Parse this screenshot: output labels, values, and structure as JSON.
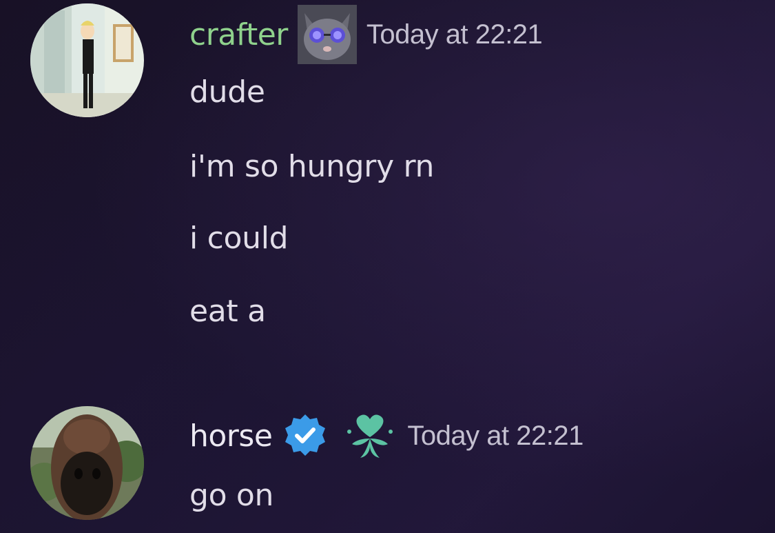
{
  "messages": [
    {
      "username": "crafter",
      "username_color": "#8fd18c",
      "timestamp": "Today at 22:21",
      "avatar_icon": "cartoon-character-avatar",
      "badge_icon": "cat-with-glasses-icon",
      "lines": [
        "dude",
        "i'm so hungry rn",
        "i could",
        "eat a"
      ]
    },
    {
      "username": "horse",
      "username_color": "#ece9f2",
      "timestamp": "Today at 22:21",
      "avatar_icon": "horse-avatar",
      "badge_icons": [
        "verified-check-icon",
        "heart-flower-icon"
      ],
      "badge_colors": {
        "verified": "#3b9be8",
        "heart": "#5cc3a3"
      },
      "lines": [
        "go on"
      ]
    }
  ]
}
